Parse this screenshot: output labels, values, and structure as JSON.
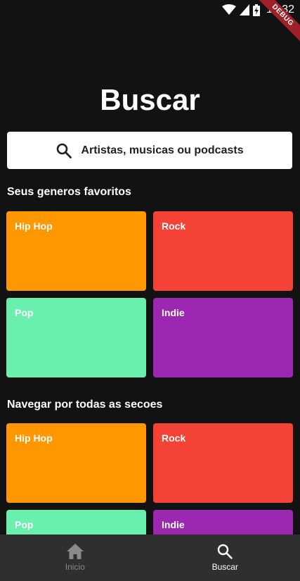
{
  "status_bar": {
    "time": "12:32",
    "debug_label": "DEBUG",
    "icons": [
      "wifi-icon",
      "signal-icon",
      "battery-icon"
    ]
  },
  "page": {
    "title": "Buscar"
  },
  "search": {
    "placeholder": "Artistas, musicas ou podcasts",
    "icon": "search-icon"
  },
  "favorites": {
    "title": "Seus generos favoritos",
    "tiles": [
      {
        "label": "Hip Hop",
        "color": "#FF9800"
      },
      {
        "label": "Rock",
        "color": "#F44336"
      },
      {
        "label": "Pop",
        "color": "#69F0AE"
      },
      {
        "label": "Indie",
        "color": "#9C27B0"
      }
    ]
  },
  "browse": {
    "title": "Navegar por todas as secoes",
    "tiles": [
      {
        "label": "Hip Hop",
        "color": "#FF9800"
      },
      {
        "label": "Rock",
        "color": "#F44336"
      },
      {
        "label": "Pop",
        "color": "#69F0AE"
      },
      {
        "label": "Indie",
        "color": "#9C27B0"
      }
    ]
  },
  "bottom_nav": {
    "items": [
      {
        "label": "Inicio",
        "icon": "home-icon",
        "active": false
      },
      {
        "label": "Buscar",
        "icon": "search-icon",
        "active": true
      }
    ]
  }
}
